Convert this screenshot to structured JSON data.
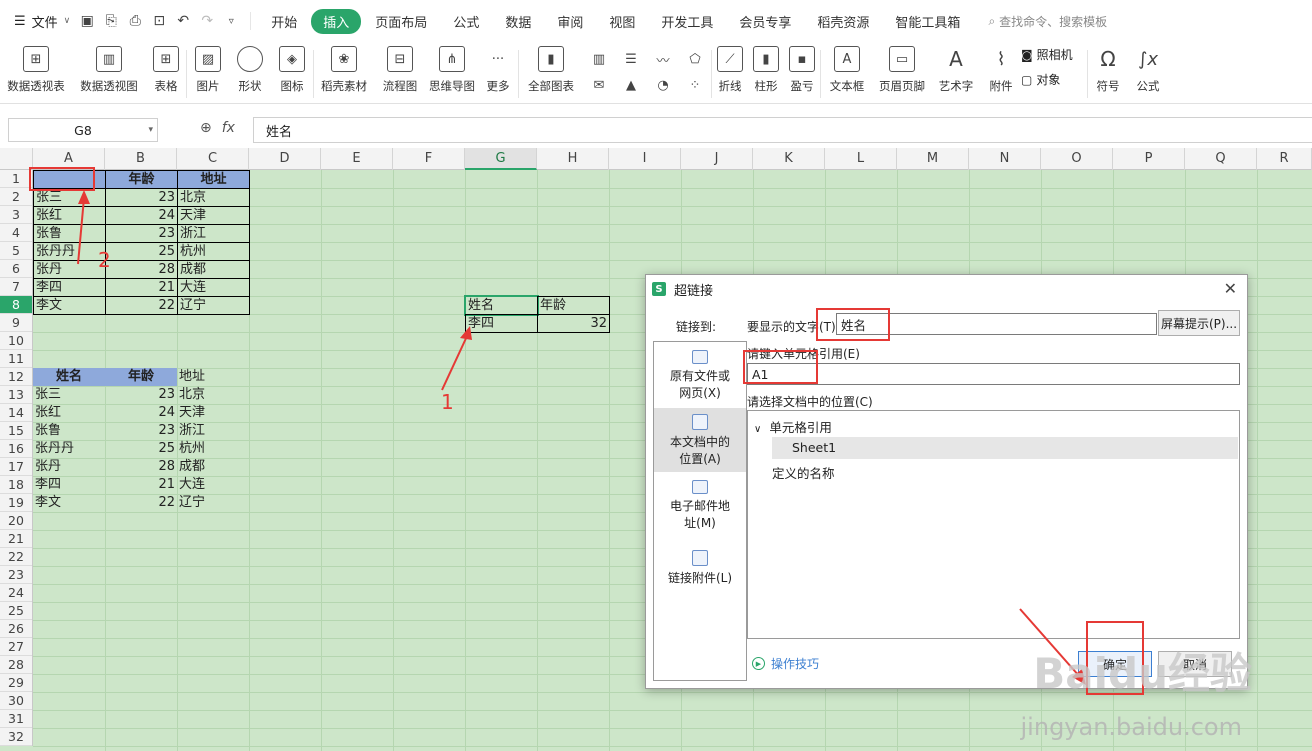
{
  "menubar": {
    "file_label": "文件",
    "tabs": [
      "开始",
      "插入",
      "页面布局",
      "公式",
      "数据",
      "审阅",
      "视图",
      "开发工具",
      "会员专享",
      "稻壳资源",
      "智能工具箱"
    ],
    "active_tab": "插入",
    "search_placeholder": "查找命令、搜索模板"
  },
  "ribbon": {
    "pivot_table": "数据透视表",
    "pivot_chart": "数据透视图",
    "table": "表格",
    "picture": "图片",
    "shape": "形状",
    "icon": "图标",
    "docer_material": "稻壳素材",
    "flowchart": "流程图",
    "mindmap": "思维导图",
    "more": "更多",
    "all_charts": "全部图表",
    "line": "折线",
    "column": "柱形",
    "winloss": "盈亏",
    "textbox": "文本框",
    "header_footer": "页眉页脚",
    "wordart": "艺术字",
    "attachment": "附件",
    "camera": "照相机",
    "object": "对象",
    "symbol": "符号",
    "formula": "公式"
  },
  "formula_bar": {
    "name_box": "G8",
    "fx": "fx",
    "content": "姓名"
  },
  "sheet": {
    "columns": [
      "A",
      "B",
      "C",
      "D",
      "E",
      "F",
      "G",
      "H",
      "I",
      "J",
      "K",
      "L",
      "M",
      "N",
      "O",
      "P",
      "Q",
      "R"
    ],
    "selected_column": "G",
    "selected_row": "8",
    "table1": {
      "headers": [
        "",
        "年龄",
        "地址"
      ],
      "rows": [
        [
          "张三",
          "23",
          "北京"
        ],
        [
          "张红",
          "24",
          "天津"
        ],
        [
          "张鲁",
          "23",
          "浙江"
        ],
        [
          "张丹丹",
          "25",
          "杭州"
        ],
        [
          "张丹",
          "28",
          "成都"
        ],
        [
          "李四",
          "21",
          "大连"
        ],
        [
          "李文",
          "22",
          "辽宁"
        ]
      ]
    },
    "table2": {
      "headers": [
        "姓名",
        "年龄",
        "地址"
      ],
      "rows": [
        [
          "张三",
          "23",
          "北京"
        ],
        [
          "张红",
          "24",
          "天津"
        ],
        [
          "张鲁",
          "23",
          "浙江"
        ],
        [
          "张丹丹",
          "25",
          "杭州"
        ],
        [
          "张丹",
          "28",
          "成都"
        ],
        [
          "李四",
          "21",
          "大连"
        ],
        [
          "李文",
          "22",
          "辽宁"
        ]
      ]
    },
    "lookup": {
      "g8": "姓名",
      "h8": "年龄",
      "g9": "李四",
      "h9": "32"
    }
  },
  "annotations": {
    "one": "1",
    "two": "2"
  },
  "dialog": {
    "title": "超链接",
    "link_to": "链接到:",
    "display_text_label": "要显示的文字(T):",
    "display_text_value": "姓名",
    "screen_tip": "屏幕提示(P)...",
    "cell_ref_label": "请键入单元格引用(E)",
    "cell_ref_value": "A1",
    "location_label": "请选择文档中的位置(C)",
    "tree_root": "单元格引用",
    "tree_sheet": "Sheet1",
    "tree_defined": "定义的名称",
    "nav_existing": "原有文件或网页(X)",
    "nav_place": "本文档中的位置(A)",
    "nav_email": "电子邮件地址(M)",
    "nav_attach": "链接附件(L)",
    "tips": "操作技巧",
    "ok": "确定",
    "cancel": "取消"
  },
  "watermark": {
    "site": "jingyan.baidu.com",
    "brand": "Baidu经验"
  },
  "colors": {
    "accent": "#2aa56a",
    "sheet_bg": "#cde6c9",
    "header_fill": "#8ea9db",
    "annotation": "#e53935"
  }
}
